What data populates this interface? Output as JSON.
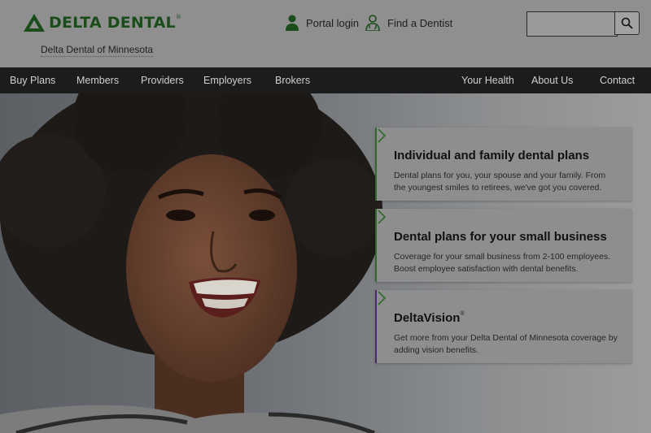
{
  "brand": {
    "logo_text": "DELTA DENTAL",
    "logo_mark_symbol": "®",
    "subbrand": "Delta Dental of Minnesota",
    "color": "#1a4d1a"
  },
  "utility": {
    "portal_login": "Portal login",
    "find_dentist": "Find a Dentist",
    "search_placeholder": ""
  },
  "nav": {
    "left": [
      "Buy Plans",
      "Members",
      "Providers",
      "Employers",
      "Brokers"
    ],
    "right": [
      "Your Health",
      "About Us",
      "Contact"
    ]
  },
  "cards": [
    {
      "title": "Individual and family dental plans",
      "description": "Dental plans for you, your spouse and your family. From the youngest smiles to retirees, we've got you covered.",
      "accent": "#2f6a2a"
    },
    {
      "title": "Dental plans for your small business",
      "description": "Coverage for your small business from 2-100 employees. Boost employee satisfaction with dental benefits.",
      "accent": "#2f6a2a"
    },
    {
      "title": "DeltaVision",
      "title_mark": "®",
      "description": "Get more from your Delta Dental of Minnesota coverage by adding vision benefits.",
      "accent": "#4a2a6a"
    }
  ]
}
